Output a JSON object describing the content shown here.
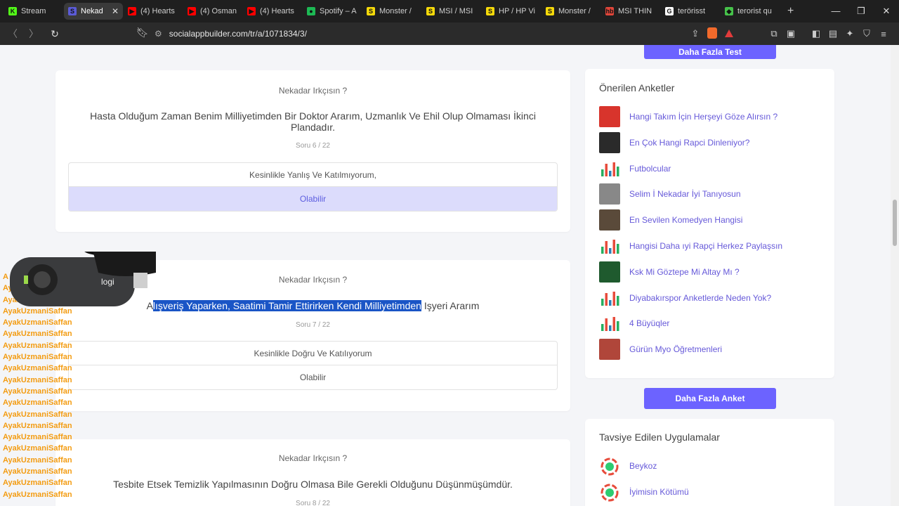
{
  "browser": {
    "tabs": [
      {
        "title": "Stream",
        "fav_color": "#53fc18",
        "fav_char": "K",
        "active": false
      },
      {
        "title": "Nekad",
        "fav_color": "#5b5bd6",
        "fav_char": "S",
        "active": true
      },
      {
        "title": "(4) Hearts",
        "fav_color": "#ff0000",
        "fav_char": "▶",
        "active": false
      },
      {
        "title": "(4) Osman",
        "fav_color": "#ff0000",
        "fav_char": "▶",
        "active": false
      },
      {
        "title": "(4) Hearts",
        "fav_color": "#ff0000",
        "fav_char": "▶",
        "active": false
      },
      {
        "title": "Spotify – A",
        "fav_color": "#1db954",
        "fav_char": "●",
        "active": false
      },
      {
        "title": "Monster /",
        "fav_color": "#f5d90a",
        "fav_char": "S",
        "active": false
      },
      {
        "title": "MSI / MSI",
        "fav_color": "#f5d90a",
        "fav_char": "S",
        "active": false
      },
      {
        "title": "HP / HP Vi",
        "fav_color": "#f5d90a",
        "fav_char": "S",
        "active": false
      },
      {
        "title": "Monster /",
        "fav_color": "#f5d90a",
        "fav_char": "S",
        "active": false
      },
      {
        "title": "MSI THIN",
        "fav_color": "#e0463a",
        "fav_char": "hb",
        "active": false
      },
      {
        "title": "terörisst",
        "fav_color": "#ffffff",
        "fav_char": "G",
        "active": false
      },
      {
        "title": "terorist qu",
        "fav_color": "#46c24a",
        "fav_char": "◆",
        "active": false
      }
    ],
    "url": "socialappbuilder.com/tr/a/1071834/3/"
  },
  "top_button": "Daha Fazla Test",
  "questions": [
    {
      "title": "Nekadar Irkçısın ?",
      "text": "Hasta Olduğum Zaman Benim Milliyetimden Bir Doktor Ararım, Uzmanlık Ve Ehil Olup Olmaması İkinci Plandadır.",
      "count": "Soru 6 / 22",
      "options": [
        "Kesinlikle Yanlış Ve Katılmıyorum,",
        "Olabilir"
      ]
    },
    {
      "title": "Nekadar Irkçısın ?",
      "text_pre": "A",
      "text_highlight": "lışveriş Yaparken, Saatimi Tamir Ettirirken Kendi Milliyetimden",
      "text_post": " Işyeri Ararım",
      "count": "Soru 7 / 22",
      "options": [
        "Kesinlikle Doğru Ve Katılıyorum",
        "Olabilir"
      ]
    },
    {
      "title": "Nekadar Irkçısın ?",
      "text": "Tesbite Etsek Temizlik Yapılmasının Doğru Olmasa Bile Gerekli Olduğunu Düşünmüşümdür.",
      "count": "Soru 8 / 22"
    }
  ],
  "sidebar": {
    "suggested_title": "Önerilen Anketler",
    "surveys": [
      {
        "label": "Hangi Takım İçin Herşeyi Göze Alırsın ?",
        "thumb": "#d8342c"
      },
      {
        "label": "En Çok Hangi Rapci Dinleniyor?",
        "thumb": "#2a2a2a"
      },
      {
        "label": "Futbolcular",
        "thumb": "chart"
      },
      {
        "label": "Selim İ Nekadar İyi Tanıyosun",
        "thumb": "#888888"
      },
      {
        "label": "En Sevilen Komedyen Hangisi",
        "thumb": "#5a4a3a"
      },
      {
        "label": "Hangisi Daha ıyi Rapçi Herkez Paylaşsın",
        "thumb": "chart"
      },
      {
        "label": "Ksk Mi Göztepe Mi Altay Mı ?",
        "thumb": "#1f5a2e"
      },
      {
        "label": "Diyabakırspor Anketlerde Neden Yok?",
        "thumb": "chart"
      },
      {
        "label": "4 Büyüqler",
        "thumb": "chart"
      },
      {
        "label": "Gürün Myo Öğretmenleri",
        "thumb": "#b0463a"
      }
    ],
    "more_surveys_button": "Daha Fazla Anket",
    "recommended_title": "Tavsiye Edilen Uygulamalar",
    "apps": [
      {
        "label": "Beykoz"
      },
      {
        "label": "İyimisin Kötümü"
      }
    ]
  },
  "stream_overlay": {
    "cam_brand": "logi",
    "chat": [
      {
        "user": "A",
        "msg": "",
        "color": "orange"
      },
      {
        "user": "AyakUzmaniSaffan",
        "msg": "",
        "color": "orange"
      },
      {
        "user": "AyakUzmaniSaffan",
        "msg": "",
        "color": "orange"
      },
      {
        "user": "AyakUzmaniSaffan",
        "msg": "",
        "color": "orange"
      },
      {
        "user": "AyakUzmaniSaffan",
        "msg": "",
        "color": "orange"
      },
      {
        "user": "AyakUzmaniSaffan",
        "msg": "",
        "color": "orange"
      },
      {
        "user": "AyakUzmaniSaffan",
        "msg": "",
        "color": "orange"
      },
      {
        "user": "AyakUzmaniSaffan",
        "msg": "",
        "color": "orange"
      },
      {
        "user": "AyakUzmaniSaffan",
        "msg": "",
        "color": "orange"
      },
      {
        "user": "AyakUzmaniSaffan",
        "msg": "",
        "color": "orange"
      },
      {
        "user": "AyakUzmaniSaffan",
        "msg": "",
        "color": "orange"
      },
      {
        "user": "AyakUzmaniSaffan",
        "msg": "",
        "color": "orange"
      },
      {
        "user": "AyakUzmaniSaffan",
        "msg": "",
        "color": "orange"
      },
      {
        "user": "AyakUzmaniSaffan",
        "msg": "",
        "color": "orange"
      },
      {
        "user": "AyakUzmaniSaffan",
        "msg": "",
        "color": "orange"
      },
      {
        "user": "AyakUzmaniSaffan",
        "msg": "",
        "color": "orange"
      },
      {
        "user": "AyakUzmaniSaffan",
        "msg": "",
        "color": "orange"
      },
      {
        "user": "AyakUzmaniSaffan",
        "msg": "",
        "color": "orange"
      },
      {
        "user": "AyakUzmaniSaffan",
        "msg": "",
        "color": "orange"
      },
      {
        "user": "AyakUzmaniSaffan",
        "msg": "",
        "color": "orange"
      }
    ]
  }
}
